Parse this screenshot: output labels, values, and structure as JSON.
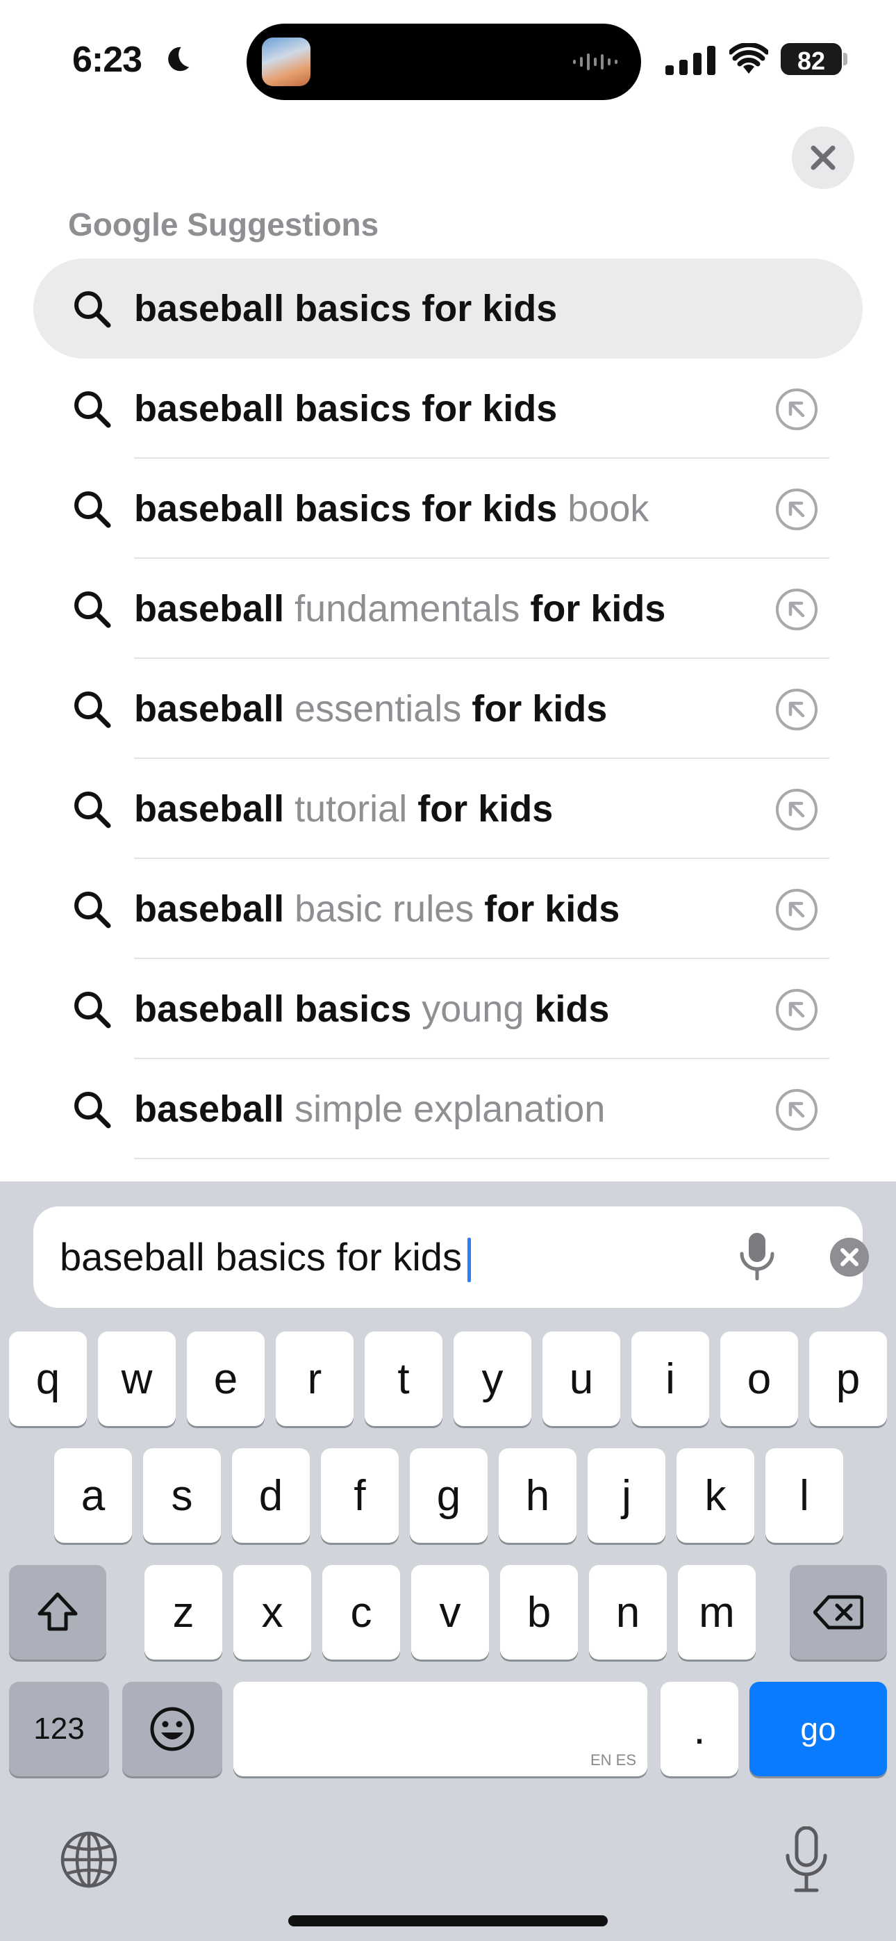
{
  "status_bar": {
    "time": "6:23",
    "battery": "82"
  },
  "suggestions": {
    "section_title": "Google Suggestions",
    "items": [
      {
        "parts": [
          {
            "t": "baseball basics for kids",
            "dim": false
          }
        ]
      },
      {
        "parts": [
          {
            "t": "baseball basics for kids",
            "dim": false
          }
        ]
      },
      {
        "parts": [
          {
            "t": "baseball basics for kids ",
            "dim": false
          },
          {
            "t": "book",
            "dim": true
          }
        ]
      },
      {
        "parts": [
          {
            "t": "baseball ",
            "dim": false
          },
          {
            "t": "fundamentals",
            "dim": true
          },
          {
            "t": " for kids",
            "dim": false
          }
        ]
      },
      {
        "parts": [
          {
            "t": "baseball ",
            "dim": false
          },
          {
            "t": "essentials",
            "dim": true
          },
          {
            "t": " for kids",
            "dim": false
          }
        ]
      },
      {
        "parts": [
          {
            "t": "baseball ",
            "dim": false
          },
          {
            "t": "tutorial",
            "dim": true
          },
          {
            "t": " for kids",
            "dim": false
          }
        ]
      },
      {
        "parts": [
          {
            "t": "baseball ",
            "dim": false
          },
          {
            "t": "basic rules",
            "dim": true
          },
          {
            "t": " for kids",
            "dim": false
          }
        ]
      },
      {
        "parts": [
          {
            "t": "baseball basics ",
            "dim": false
          },
          {
            "t": "young",
            "dim": true
          },
          {
            "t": " kids",
            "dim": false
          }
        ]
      },
      {
        "parts": [
          {
            "t": "baseball ",
            "dim": false
          },
          {
            "t": "simple explanation",
            "dim": true
          }
        ]
      }
    ]
  },
  "search": {
    "value": "baseball basics for kids"
  },
  "keyboard": {
    "row1": [
      "q",
      "w",
      "e",
      "r",
      "t",
      "y",
      "u",
      "i",
      "o",
      "p"
    ],
    "row2": [
      "a",
      "s",
      "d",
      "f",
      "g",
      "h",
      "j",
      "k",
      "l"
    ],
    "row3": [
      "z",
      "x",
      "c",
      "v",
      "b",
      "n",
      "m"
    ],
    "numbers_label": "123",
    "period_label": ".",
    "go_label": "go",
    "space_hint": "EN ES"
  },
  "icons": {
    "search": "search-icon",
    "fill": "arrow-up-left-fill-icon",
    "close": "close-icon",
    "mic": "microphone-icon",
    "clear": "clear-text-icon",
    "shift": "shift-icon",
    "delete": "delete-icon",
    "emoji": "emoji-icon",
    "globe": "globe-icon"
  },
  "colors": {
    "accent": "#0a7aff",
    "caret": "#2f7df6",
    "dim_text": "#8e8e93",
    "keyboard_bg": "#d1d4db"
  }
}
